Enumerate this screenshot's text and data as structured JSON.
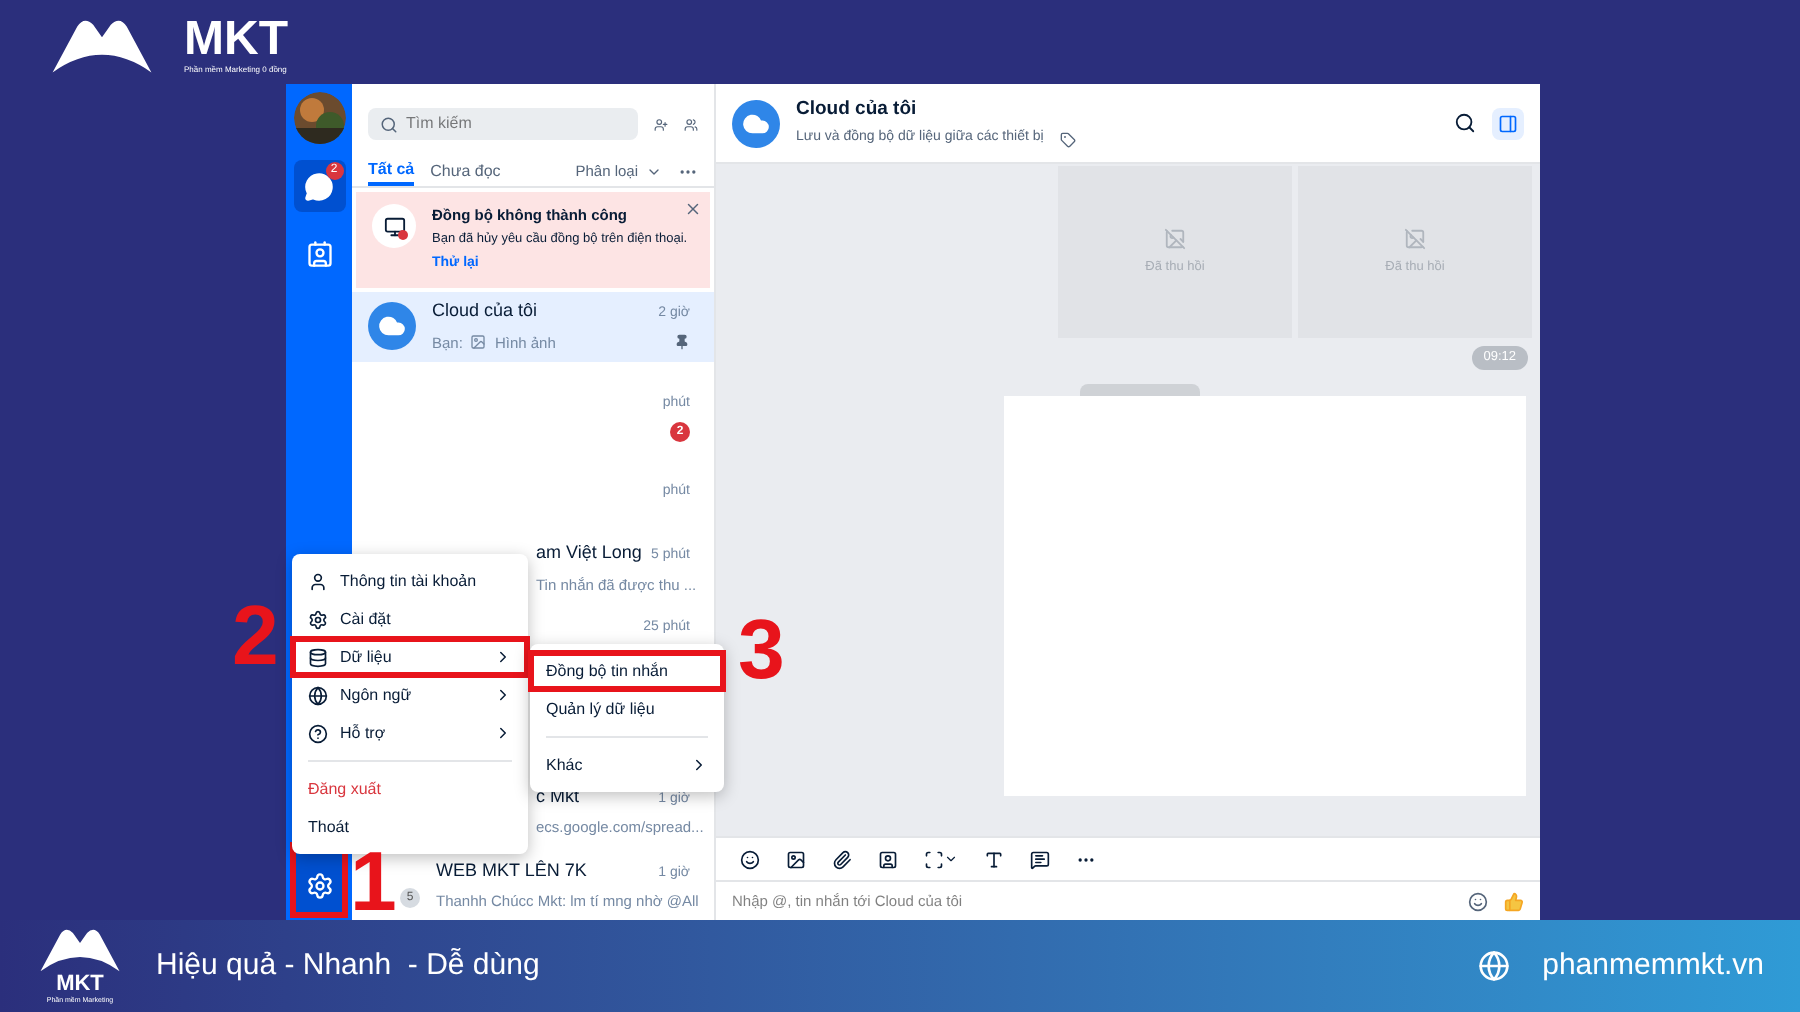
{
  "brand": {
    "logo_text": "MKT",
    "tagline": "Phần mềm Marketing 0 đồng"
  },
  "sidebar": {
    "chat_badge": "2",
    "settings": {
      "selected": true,
      "annotation": "1"
    }
  },
  "search": {
    "placeholder": "Tìm kiếm"
  },
  "tabs": [
    {
      "label": "Tất cả",
      "selected": true
    },
    {
      "label": "Chưa đọc",
      "selected": false
    }
  ],
  "filter": {
    "label": "Phân loại"
  },
  "sync_banner": {
    "title": "Đồng bộ không thành công",
    "body": "Bạn đã hủy yêu cầu đồng bộ trên điện thoại.",
    "action": "Thử lại"
  },
  "conversations": [
    {
      "kind": "full",
      "name": "Cloud của tôi",
      "time": "2 giờ",
      "preview_prefix": "Bạn:",
      "preview": "Hình ảnh",
      "pinned": true,
      "selected": true
    },
    {
      "kind": "blurred",
      "times": [
        "phút",
        "phút"
      ],
      "badge": "2",
      "selected": false
    },
    {
      "kind": "covered",
      "name": "am Việt Long",
      "time": "5 phút",
      "preview": "Tin nhắn đã được thu ...",
      "selected": false
    },
    {
      "kind": "covered_tall",
      "time": "25 phút",
      "selected": false
    },
    {
      "kind": "covered",
      "name": "c Mkt",
      "time": "1 giờ",
      "preview": "ecs.google.com/spread...",
      "selected": false
    },
    {
      "kind": "group",
      "name": "WEB MKT LÊN 7K",
      "time": "1 giờ",
      "preview": "Thanhh Chúcc Mkt: lm tí mng nhờ @All",
      "member_count": "5",
      "selected": false
    }
  ],
  "menu": {
    "items": [
      {
        "kind": "item",
        "label": "Thông tin tài khoản",
        "submenu": false
      },
      {
        "kind": "item",
        "label": "Cài đặt",
        "submenu": false
      },
      {
        "kind": "item",
        "label": "Dữ liệu",
        "submenu": true,
        "annotation": "2"
      },
      {
        "kind": "item",
        "label": "Ngôn ngữ",
        "submenu": true
      },
      {
        "kind": "item",
        "label": "Hỗ trợ",
        "submenu": true
      },
      {
        "kind": "separator"
      },
      {
        "kind": "danger",
        "label": "Đăng xuất"
      },
      {
        "kind": "plain",
        "label": "Thoát"
      }
    ]
  },
  "submenu": {
    "items": [
      {
        "kind": "item",
        "label": "Đồng bộ tin nhắn",
        "submenu": false,
        "annotation": "3"
      },
      {
        "kind": "item",
        "label": "Quản lý dữ liệu",
        "submenu": false
      },
      {
        "kind": "separator"
      },
      {
        "kind": "item",
        "label": "Khác",
        "submenu": true
      }
    ]
  },
  "chat": {
    "title": "Cloud của tôi",
    "subtitle": "Lưu và đồng bộ dữ liệu giữa các thiết bị",
    "recalled": [
      "Đã thu hồi",
      "Đã thu hồi"
    ],
    "time": "09:12",
    "input_placeholder": "Nhập @, tin nhắn tới Cloud của tôi"
  },
  "footer": {
    "logo_text": "MKT",
    "logo_tagline": "Phần mềm Marketing",
    "slogan": "Hiệu quả - Nhanh  - Dễ dùng",
    "website": "phanmemmkt.vn"
  }
}
